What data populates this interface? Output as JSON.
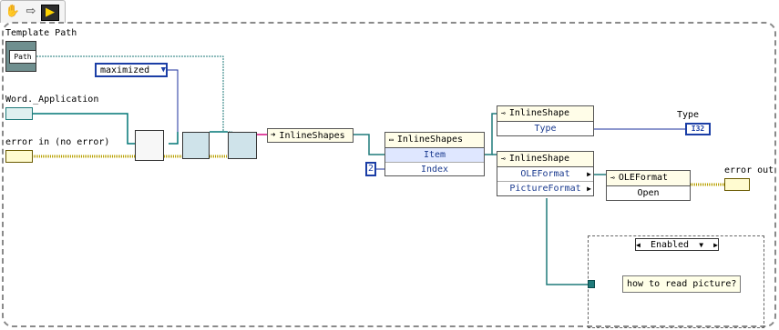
{
  "toolbar": {
    "icons": [
      "hand-icon",
      "arrow-right-icon",
      "run-arrow-icon"
    ]
  },
  "controls": {
    "template_path_label": "Template Path",
    "path_glyph": "Path",
    "word_app_label": "Word._Application",
    "error_in_label": "error in (no error)",
    "window_state": "maximized",
    "index_constant": "2"
  },
  "nodes": {
    "inline_shapes_ref": "InlineShapes",
    "inline_shapes_prop": {
      "title": "InlineShapes",
      "rows": [
        "Item",
        "Index"
      ]
    },
    "inline_shape_type": {
      "title": "InlineShape",
      "rows": [
        "Type"
      ]
    },
    "inline_shape_props": {
      "title": "InlineShape",
      "rows": [
        "OLEFormat",
        "PictureFormat"
      ]
    },
    "ole_format": {
      "title": "OLEFormat",
      "rows": [
        "Open"
      ]
    }
  },
  "indicators": {
    "type_label": "Type",
    "type_terminal": "I32",
    "error_out_label": "error out"
  },
  "case": {
    "selector": "Enabled",
    "comment": "how to read picture?"
  },
  "colors": {
    "wire_blue": "#1b2f9e",
    "wire_teal": "#1f7a7a",
    "wire_error": "#b8a000",
    "wire_refnum": "#007777",
    "wire_pink": "#e24aa0"
  }
}
